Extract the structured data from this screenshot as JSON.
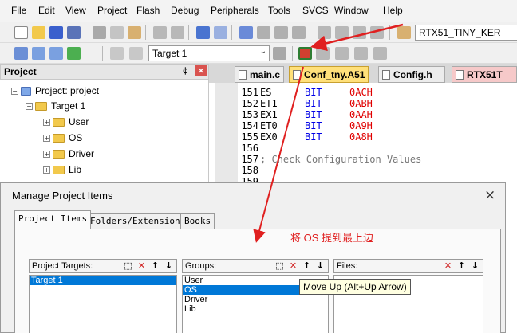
{
  "menu": [
    "File",
    "Edit",
    "View",
    "Project",
    "Flash",
    "Debug",
    "Peripherals",
    "Tools",
    "SVCS",
    "Window",
    "Help"
  ],
  "toolbar": {
    "project_combo": "RTX51_TINY_KER",
    "target_combo": "Target 1"
  },
  "project_panel": {
    "title": "Project",
    "pin_glyph": "ᛰ",
    "close_glyph": "×",
    "root": "Project: project",
    "target": "Target 1",
    "groups": [
      "User",
      "OS",
      "Driver",
      "Lib"
    ]
  },
  "editor": {
    "tabs": [
      "main.c",
      "Conf_tny.A51",
      "Config.h",
      "RTX51T"
    ],
    "active_tab": "Conf_tny.A51",
    "lines": [
      {
        "num": "151",
        "name": "ES",
        "kw": "BIT",
        "val": "0ACH"
      },
      {
        "num": "152",
        "name": "ET1",
        "kw": "BIT",
        "val": "0ABH"
      },
      {
        "num": "153",
        "name": "EX1",
        "kw": "BIT",
        "val": "0AAH"
      },
      {
        "num": "154",
        "name": "ET0",
        "kw": "BIT",
        "val": "0A9H"
      },
      {
        "num": "155",
        "name": "EX0",
        "kw": "BIT",
        "val": "0A8H"
      },
      {
        "num": "156",
        "name": "",
        "kw": "",
        "val": ""
      },
      {
        "num": "157",
        "name": "; Check Configuration Values",
        "kw": "",
        "val": ""
      },
      {
        "num": "158",
        "name": "",
        "kw": "",
        "val": ""
      },
      {
        "num": "159",
        "name": "",
        "kw": "",
        "val": ""
      }
    ]
  },
  "dialog": {
    "title": "Manage Project Items",
    "close": "×",
    "tabs": [
      "Project Items",
      "Folders/Extensions",
      "Books"
    ],
    "targets_label": "Project Targets:",
    "groups_label": "Groups:",
    "files_label": "Files:",
    "targets": [
      "Target 1"
    ],
    "groups": [
      "User",
      "OS",
      "Driver",
      "Lib"
    ],
    "selected_group": "OS",
    "btn_new": "⬚",
    "btn_delete": "✕",
    "btn_up": "↑",
    "btn_down": "↓"
  },
  "annotation": "将 OS 提到最上边",
  "tooltip": "Move Up (Alt+Up Arrow)",
  "colors": {
    "accent_red": "#e02020",
    "selection": "#0078d7",
    "active_tab": "#ffe07a"
  }
}
